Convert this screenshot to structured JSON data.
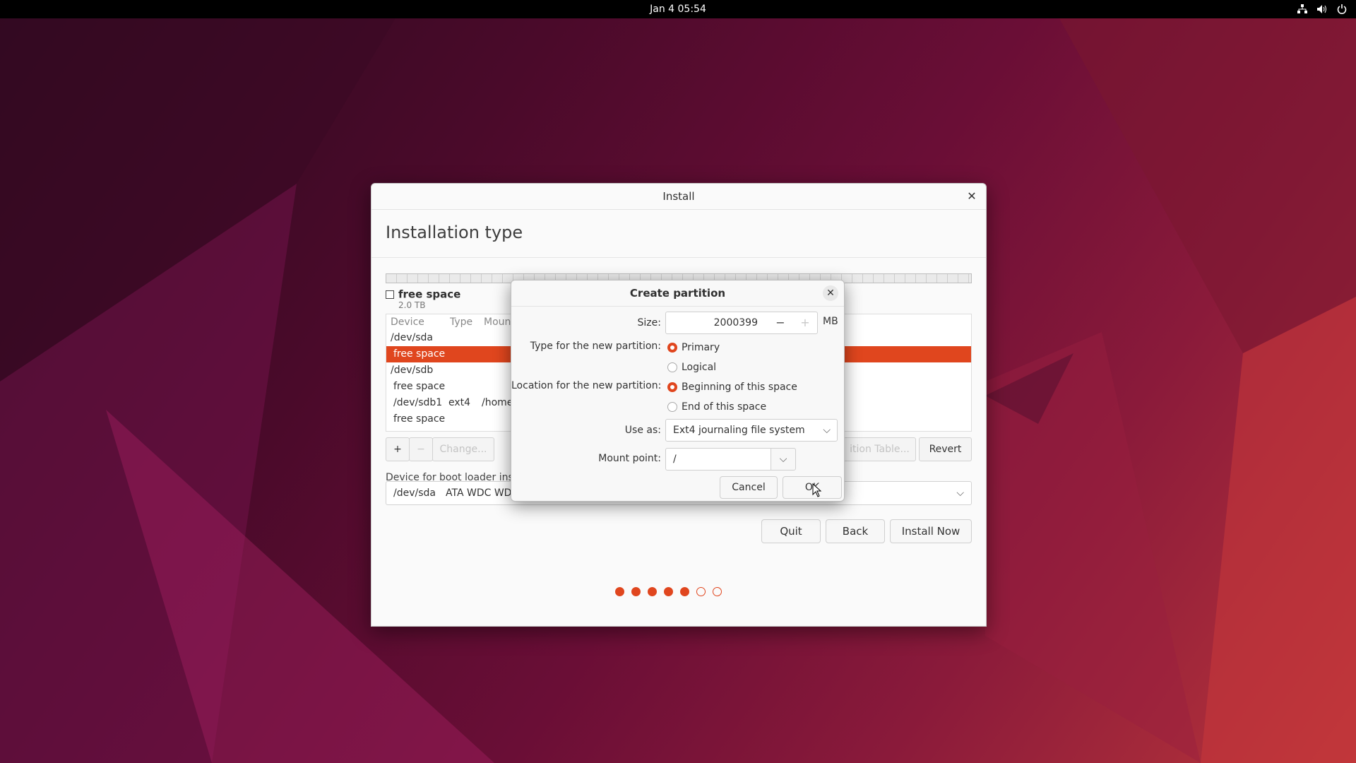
{
  "topbar": {
    "clock": "Jan 4  05:54"
  },
  "icons": {
    "network": "network-icon",
    "volume": "volume-icon",
    "power": "power-icon"
  },
  "window": {
    "title": "Install",
    "page_title": "Installation type"
  },
  "legend": {
    "label": "free space",
    "size": "2.0 TB"
  },
  "table": {
    "headers": [
      "Device",
      "Type",
      "Moun"
    ],
    "rows": [
      {
        "device": "/dev/sda",
        "type": "",
        "mount": "",
        "selected": false
      },
      {
        "device": "free space",
        "type": "",
        "mount": "",
        "selected": true
      },
      {
        "device": "/dev/sdb",
        "type": "",
        "mount": "",
        "selected": false
      },
      {
        "device": "free space",
        "type": "",
        "mount": "",
        "selected": false
      },
      {
        "device": "/dev/sdb1",
        "type": "ext4",
        "mount": "/home",
        "selected": false
      },
      {
        "device": "free space",
        "type": "",
        "mount": "",
        "selected": false
      }
    ]
  },
  "table_buttons": {
    "add": "+",
    "remove": "−",
    "change": "Change...",
    "new_table": "ition Table...",
    "revert": "Revert"
  },
  "bootloader": {
    "label": "Device for boot loader inst",
    "device": "/dev/sda",
    "model": "ATA WDC WD2"
  },
  "nav": {
    "quit": "Quit",
    "back": "Back",
    "install": "Install Now"
  },
  "progress": {
    "total_steps": 7,
    "current_step": 5
  },
  "dialog": {
    "title": "Create partition",
    "size_label": "Size:",
    "size_value": "2000399",
    "size_minus": "−",
    "size_plus": "+",
    "size_unit": "MB",
    "type_label": "Type for the new partition:",
    "type_primary": "Primary",
    "type_logical": "Logical",
    "location_label": "Location for the new partition:",
    "loc_beginning": "Beginning of this space",
    "loc_end": "End of this space",
    "use_as_label": "Use as:",
    "use_as_value": "Ext4 journaling file system",
    "mount_label": "Mount point:",
    "mount_value": "/",
    "cancel": "Cancel",
    "ok": "OK"
  },
  "colors": {
    "accent": "#e0461e",
    "topbar": "#000000"
  }
}
